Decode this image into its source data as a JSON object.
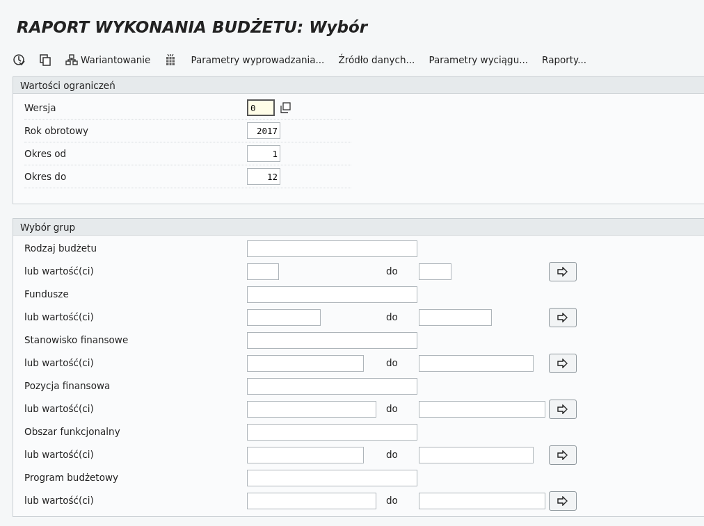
{
  "title": "RAPORT WYKONANIA BUDŻETU: Wybór",
  "toolbar": [
    {
      "kind": "icon"
    },
    {
      "kind": "icon"
    },
    {
      "kind": "button",
      "label": "Wariantowanie"
    },
    {
      "kind": "icon"
    },
    {
      "kind": "button",
      "label": "Parametry wyprowadzania..."
    },
    {
      "kind": "button",
      "label": "Źródło danych..."
    },
    {
      "kind": "button",
      "label": "Parametry wyciągu..."
    },
    {
      "kind": "button",
      "label": "Raporty..."
    }
  ],
  "restrictions": {
    "title": "Wartości ograniczeń",
    "fields": [
      {
        "label": "Wersja",
        "value": "0",
        "kind": "help",
        "focused": true
      },
      {
        "label": "Rok obrotowy",
        "value": "2017",
        "kind": "number",
        "focused": false
      },
      {
        "label": "Okres od",
        "value": "1",
        "kind": "number",
        "focused": false
      },
      {
        "label": "Okres do",
        "value": "12",
        "kind": "number",
        "focused": false
      }
    ]
  },
  "groups": {
    "title": "Wybór grup",
    "items": [
      {
        "label": "Rodzaj budżetu",
        "range_label": "lub wartość(ci)",
        "to_label": "do"
      },
      {
        "label": "Fundusze",
        "range_label": "lub wartość(ci)",
        "to_label": "do"
      },
      {
        "label": "Stanowisko finansowe",
        "range_label": "lub wartość(ci)",
        "to_label": "do"
      },
      {
        "label": "Pozycja finansowa",
        "range_label": "lub wartość(ci)",
        "to_label": "do"
      },
      {
        "label": "Obszar funkcjonalny",
        "range_label": "lub wartość(ci)",
        "to_label": "do"
      },
      {
        "label": "Program budżetowy",
        "range_label": "lub wartość(ci)",
        "to_label": "do"
      }
    ]
  }
}
